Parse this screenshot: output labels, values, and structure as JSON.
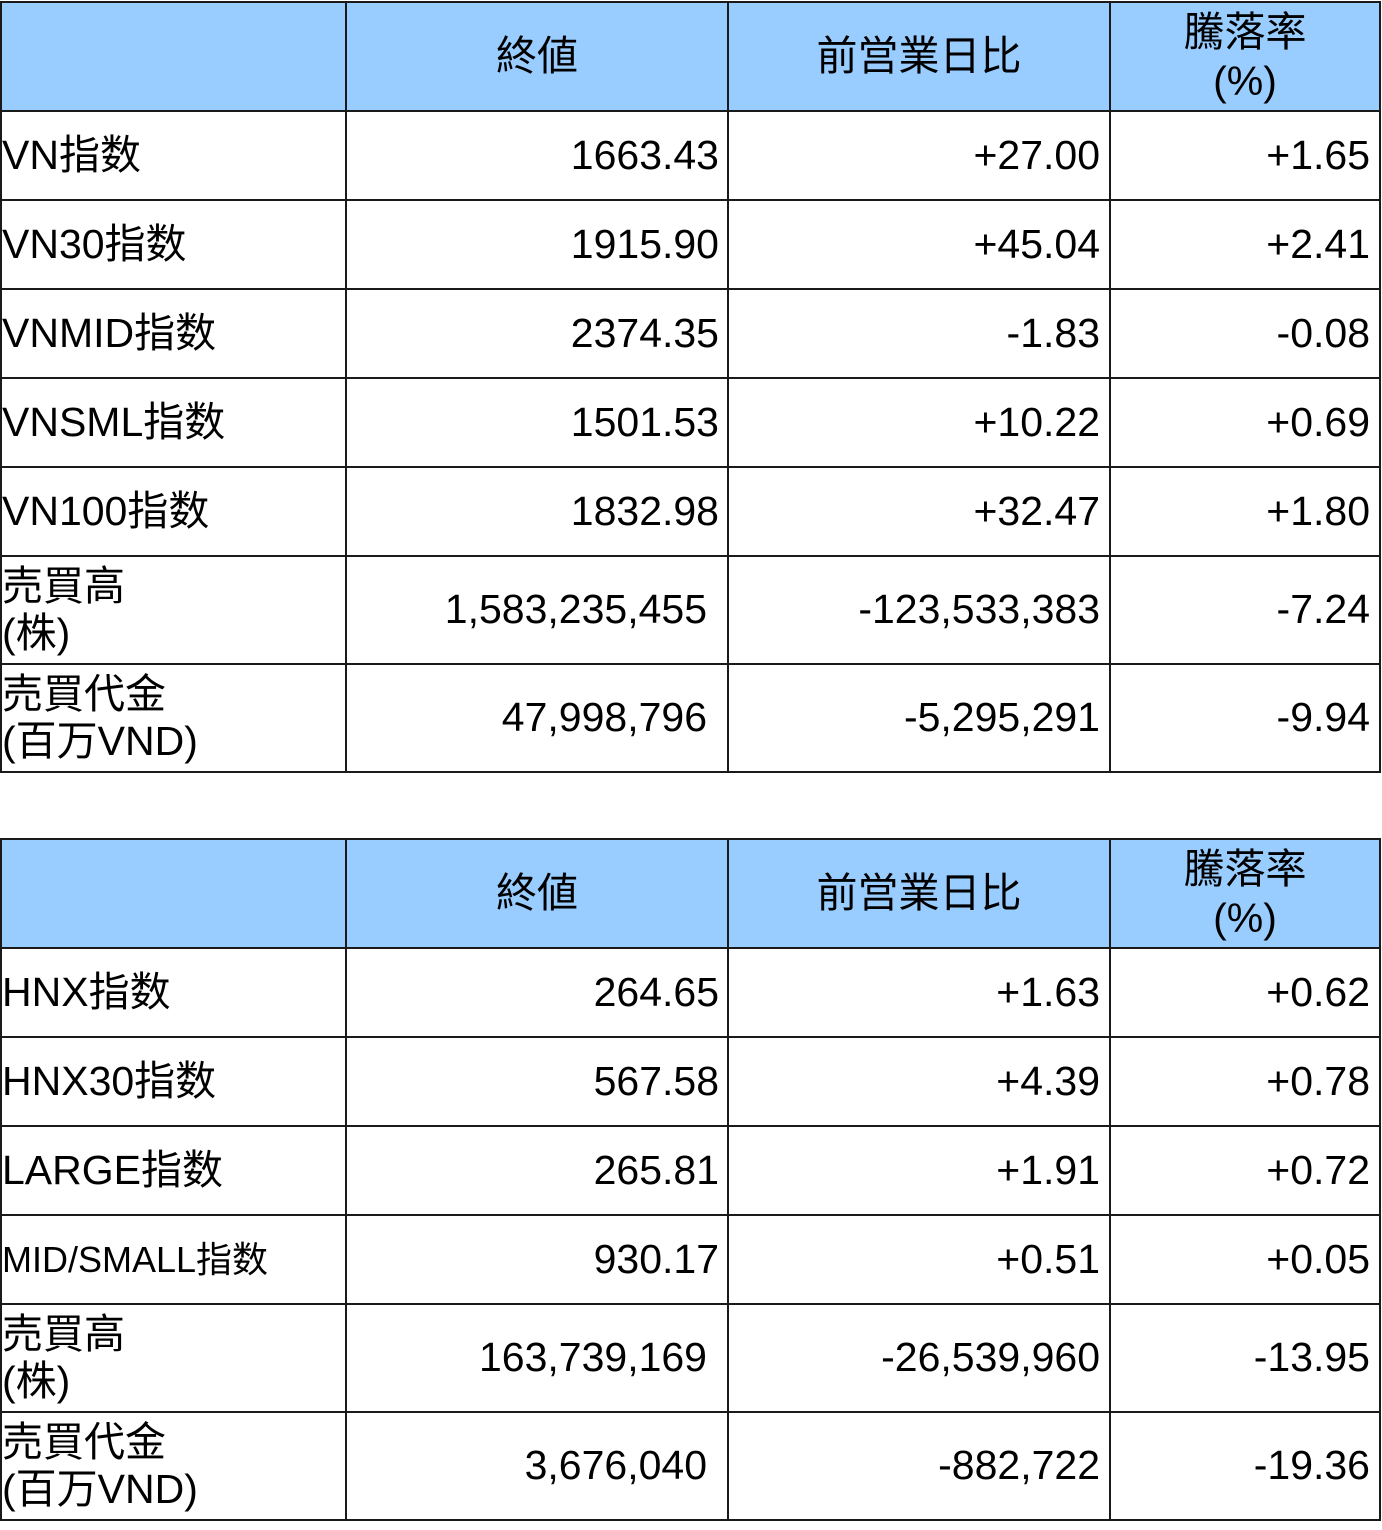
{
  "headers": {
    "blank": "",
    "close": "終値",
    "diff": "前営業日比",
    "pct_line1": "騰落率",
    "pct_line2": "(%)"
  },
  "hose": {
    "rows": [
      {
        "label": "VN指数",
        "close": "1663.43",
        "diff": "+27.00",
        "pct": "+1.65"
      },
      {
        "label": "VN30指数",
        "close": "1915.90",
        "diff": "+45.04",
        "pct": "+2.41"
      },
      {
        "label": "VNMID指数",
        "close": "2374.35",
        "diff": "-1.83",
        "pct": "-0.08"
      },
      {
        "label": "VNSML指数",
        "close": "1501.53",
        "diff": "+10.22",
        "pct": "+0.69"
      },
      {
        "label": "VN100指数",
        "close": "1832.98",
        "diff": "+32.47",
        "pct": "+1.80"
      },
      {
        "label1": "売買高",
        "label2": "(株)",
        "close": "1,583,235,455",
        "diff": "-123,533,383",
        "pct": "-7.24"
      },
      {
        "label1": "売買代金",
        "label2": "(百万VND)",
        "close": "47,998,796",
        "diff": "-5,295,291",
        "pct": "-9.94"
      }
    ]
  },
  "hnx": {
    "rows": [
      {
        "label": "HNX指数",
        "close": "264.65",
        "diff": "+1.63",
        "pct": "+0.62"
      },
      {
        "label": "HNX30指数",
        "close": "567.58",
        "diff": "+4.39",
        "pct": "+0.78"
      },
      {
        "label": "LARGE指数",
        "close": "265.81",
        "diff": "+1.91",
        "pct": "+0.72"
      },
      {
        "label": "MID/SMALL指数",
        "close": "930.17",
        "diff": "+0.51",
        "pct": "+0.05"
      },
      {
        "label1": "売買高",
        "label2": "(株)",
        "close": "163,739,169",
        "diff": "-26,539,960",
        "pct": "-13.95"
      },
      {
        "label1": "売買代金",
        "label2": "(百万VND)",
        "close": "3,676,040",
        "diff": "-882,722",
        "pct": "-19.36"
      }
    ]
  },
  "colors": {
    "header_bg": "#99ccff",
    "border": "#1a1a1a",
    "text": "#000000"
  }
}
